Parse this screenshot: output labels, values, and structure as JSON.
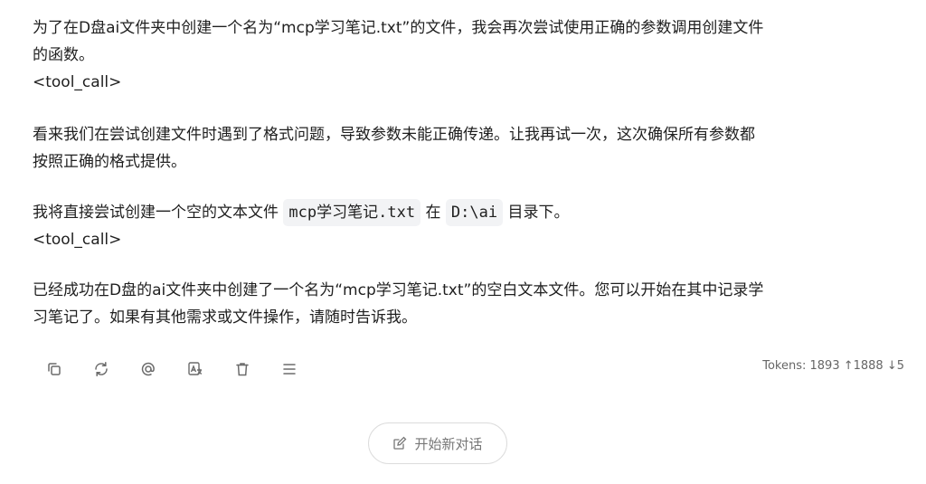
{
  "message": {
    "p1_line1": "为了在D盘ai文件夹中创建一个名为“mcp学习笔记.txt”的文件，我会再次尝试使用正确的参数调用创建文件",
    "p1_line2": "的函数。",
    "tool_call_1": "<tool_call>",
    "p2_line1": "看来我们在尝试创建文件时遇到了格式问题，导致参数未能正确传递。让我再试一次，这次确保所有参数都",
    "p2_line2": "按照正确的格式提供。",
    "p3_prefix": "我将直接尝试创建一个空的文本文件 ",
    "p3_code_filename": "mcp学习笔记.txt",
    "p3_middle": " 在 ",
    "p3_code_dir": "D:\\ai",
    "p3_suffix": " 目录下。",
    "tool_call_2": "<tool_call>",
    "p4_line1": "已经成功在D盘的ai文件夹中创建了一个名为“mcp学习笔记.txt”的空白文本文件。您可以开始在其中记录学",
    "p4_line2": "习笔记了。如果有其他需求或文件操作，请随时告诉我。"
  },
  "actions": {
    "icons": [
      "copy-icon",
      "regenerate-icon",
      "mention-icon",
      "translate-icon",
      "delete-icon",
      "menu-icon"
    ]
  },
  "tokens": "Tokens: 1893 ↑1888 ↓5",
  "new_chat": {
    "label": "开始新对话",
    "icon": "edit-icon"
  },
  "colors": {
    "text": "#1f1f1f",
    "icon": "#6b6b6b",
    "code_bg": "#f2f3f5"
  }
}
